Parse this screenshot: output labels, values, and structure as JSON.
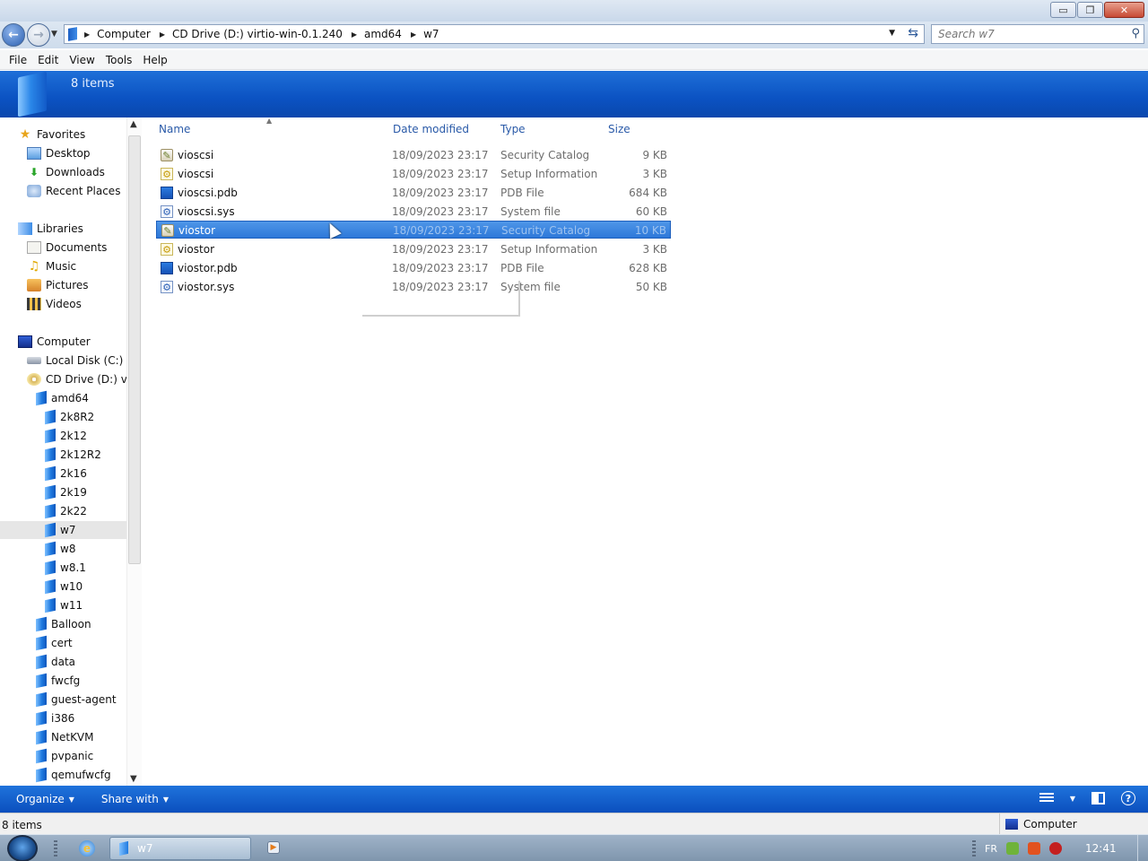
{
  "window": {
    "buttons": {
      "minimize": "▭",
      "maximize": "❐",
      "close": "✕"
    }
  },
  "address": {
    "crumbs": [
      "Computer",
      "CD Drive (D:) virtio-win-0.1.240",
      "amd64",
      "w7"
    ],
    "search_placeholder": "Search w7"
  },
  "menu": [
    "File",
    "Edit",
    "View",
    "Tools",
    "Help"
  ],
  "header": {
    "item_count": "8 items"
  },
  "nav": {
    "favorites": "Favorites",
    "desktop": "Desktop",
    "downloads": "Downloads",
    "recent": "Recent Places",
    "libraries": "Libraries",
    "documents": "Documents",
    "music": "Music",
    "pictures": "Pictures",
    "videos": "Videos",
    "computer": "Computer",
    "local_disk": "Local Disk (C:)",
    "cd_drive": "CD Drive (D:) virt",
    "amd64": "amd64",
    "amd64_children": [
      "2k8R2",
      "2k12",
      "2k12R2",
      "2k16",
      "2k19",
      "2k22",
      "w7",
      "w8",
      "w8.1",
      "w10",
      "w11"
    ],
    "root_folders": [
      "Balloon",
      "cert",
      "data",
      "fwcfg",
      "guest-agent",
      "i386",
      "NetKVM",
      "pvpanic",
      "qemufwcfg"
    ],
    "selected": "w7"
  },
  "columns": {
    "name": "Name",
    "date": "Date modified",
    "type": "Type",
    "size": "Size"
  },
  "files": [
    {
      "name": "vioscsi",
      "date": "18/09/2023 23:17",
      "type": "Security Catalog",
      "size": "9 KB",
      "icon": "catalog-icon"
    },
    {
      "name": "vioscsi",
      "date": "18/09/2023 23:17",
      "type": "Setup Information",
      "size": "3 KB",
      "icon": "inf-icon"
    },
    {
      "name": "vioscsi.pdb",
      "date": "18/09/2023 23:17",
      "type": "PDB File",
      "size": "684 KB",
      "icon": "pdb-icon"
    },
    {
      "name": "vioscsi.sys",
      "date": "18/09/2023 23:17",
      "type": "System file",
      "size": "60 KB",
      "icon": "sys-icon"
    },
    {
      "name": "viostor",
      "date": "18/09/2023 23:17",
      "type": "Security Catalog",
      "size": "10 KB",
      "icon": "catalog-icon",
      "selected": true
    },
    {
      "name": "viostor",
      "date": "18/09/2023 23:17",
      "type": "Setup Information",
      "size": "3 KB",
      "icon": "inf-icon"
    },
    {
      "name": "viostor.pdb",
      "date": "18/09/2023 23:17",
      "type": "PDB File",
      "size": "628 KB",
      "icon": "pdb-icon"
    },
    {
      "name": "viostor.sys",
      "date": "18/09/2023 23:17",
      "type": "System file",
      "size": "50 KB",
      "icon": "sys-icon"
    }
  ],
  "commandbar": {
    "organize": "Organize",
    "share": "Share with"
  },
  "status": {
    "items": "8 items",
    "zone": "Computer"
  },
  "taskbar": {
    "task_label": "w7",
    "lang": "FR",
    "clock": "12:41"
  },
  "colors": {
    "accent": "#0b52c2",
    "selection": "#2d78d9",
    "link": "#2a5aa8"
  }
}
